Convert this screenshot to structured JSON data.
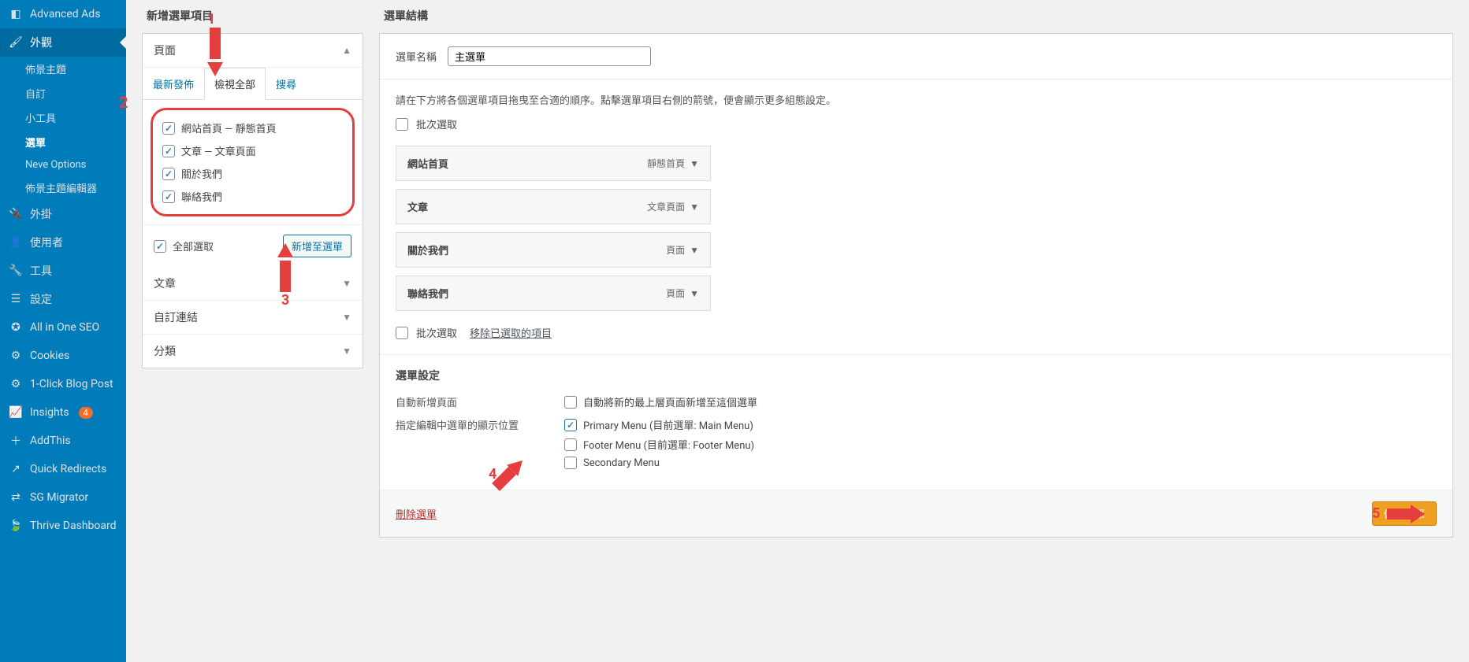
{
  "sidebar": {
    "items": [
      {
        "label": "Advanced Ads",
        "icon": "◧"
      },
      {
        "label": "外觀",
        "icon": "🖌",
        "active": true
      },
      {
        "label": "外掛",
        "icon": "🔌"
      },
      {
        "label": "使用者",
        "icon": "👤"
      },
      {
        "label": "工具",
        "icon": "🔧"
      },
      {
        "label": "設定",
        "icon": "☰"
      },
      {
        "label": "All in One SEO",
        "icon": "✪"
      },
      {
        "label": "Cookies",
        "icon": "⚙"
      },
      {
        "label": "1-Click Blog Post",
        "icon": "⚙"
      },
      {
        "label": "Insights",
        "icon": "📈",
        "badge": "4"
      },
      {
        "label": "AddThis",
        "icon": "＋"
      },
      {
        "label": "Quick Redirects",
        "icon": "↗"
      },
      {
        "label": "SG Migrator",
        "icon": "⇄"
      },
      {
        "label": "Thrive Dashboard",
        "icon": "🍃"
      }
    ],
    "subitems": [
      {
        "label": "佈景主題"
      },
      {
        "label": "自訂"
      },
      {
        "label": "小工具"
      },
      {
        "label": "選單",
        "current": true
      },
      {
        "label": "Neve Options"
      },
      {
        "label": "佈景主題編輯器"
      }
    ]
  },
  "addItems": {
    "heading": "新增選單項目",
    "accordion_pages": "頁面",
    "tabs": {
      "recent": "最新發佈",
      "all": "檢視全部",
      "search": "搜尋"
    },
    "pages": [
      {
        "label": "網站首頁 — 靜態首頁"
      },
      {
        "label": "文章 — 文章頁面"
      },
      {
        "label": "關於我們"
      },
      {
        "label": "聯絡我們"
      }
    ],
    "select_all": "全部選取",
    "add_to_menu": "新增至選單",
    "accordion_posts": "文章",
    "accordion_links": "自訂連結",
    "accordion_cats": "分類"
  },
  "structure": {
    "heading": "選單結構",
    "name_label": "選單名稱",
    "name_value": "主選單",
    "help": "請在下方將各個選單項目拖曳至合適的順序。點擊選單項目右側的箭號，便會顯示更多組態設定。",
    "batch": "批次選取",
    "menuItems": [
      {
        "label": "網站首頁",
        "type": "靜態首頁"
      },
      {
        "label": "文章",
        "type": "文章頁面"
      },
      {
        "label": "關於我們",
        "type": "頁面"
      },
      {
        "label": "聯絡我們",
        "type": "頁面"
      }
    ],
    "batch2": "批次選取",
    "remove_selected": "移除已選取的項目"
  },
  "settings": {
    "heading": "選單設定",
    "auto_add_label": "自動新增頁面",
    "auto_add_opt": "自動將新的最上層頁面新增至這個選單",
    "location_label": "指定編輯中選單的顯示位置",
    "loc1": "Primary Menu (目前選單: Main Menu)",
    "loc2": "Footer Menu (目前選單: Footer Menu)",
    "loc3": "Secondary Menu"
  },
  "footer": {
    "delete": "刪除選單",
    "save": "儲存選單"
  },
  "anno": {
    "n1": "1",
    "n2": "2",
    "n3": "3",
    "n4": "4",
    "n5": "5"
  }
}
